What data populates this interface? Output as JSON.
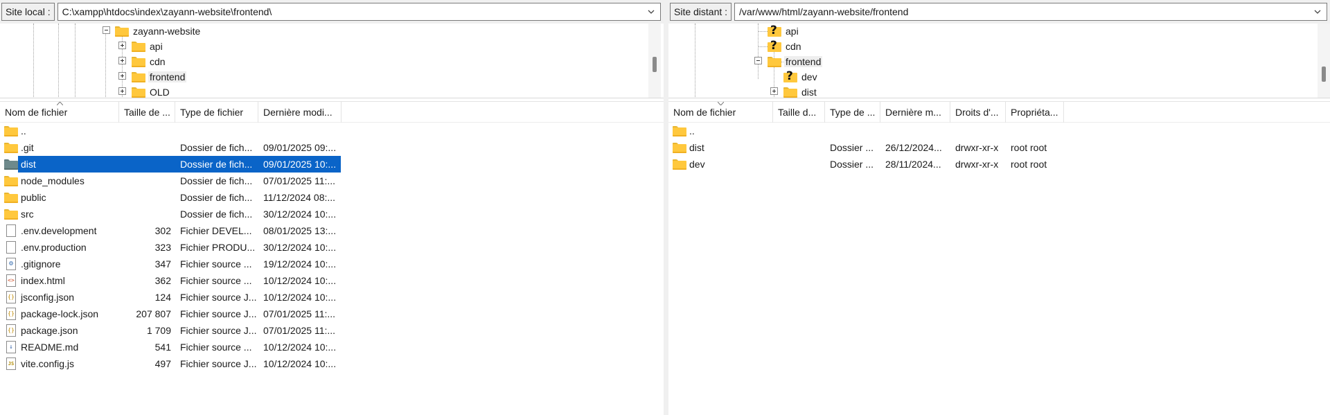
{
  "local": {
    "label": "Site local :",
    "path": "C:\\xampp\\htdocs\\index\\zayann-website\\frontend\\",
    "tree": [
      {
        "label": "zayann-website",
        "expanded": true
      },
      {
        "label": "api"
      },
      {
        "label": "cdn"
      },
      {
        "label": "frontend"
      },
      {
        "label": "OLD"
      }
    ],
    "columns": [
      "Nom de fichier",
      "Taille de ...",
      "Type de fichier",
      "Dernière modi..."
    ],
    "files": [
      {
        "name": "..",
        "size": "",
        "type": "",
        "modified": "",
        "icon": "folder"
      },
      {
        "name": ".git",
        "size": "",
        "type": "Dossier de fich...",
        "modified": "09/01/2025 09:...",
        "icon": "folder"
      },
      {
        "name": "dist",
        "size": "",
        "type": "Dossier de fich...",
        "modified": "09/01/2025 10:...",
        "icon": "folder-dark",
        "selected": true
      },
      {
        "name": "node_modules",
        "size": "",
        "type": "Dossier de fich...",
        "modified": "07/01/2025 11:...",
        "icon": "folder"
      },
      {
        "name": "public",
        "size": "",
        "type": "Dossier de fich...",
        "modified": "11/12/2024 08:...",
        "icon": "folder"
      },
      {
        "name": "src",
        "size": "",
        "type": "Dossier de fich...",
        "modified": "30/12/2024 10:...",
        "icon": "folder"
      },
      {
        "name": ".env.development",
        "size": "302",
        "type": "Fichier DEVEL...",
        "modified": "08/01/2025 13:...",
        "icon": "file"
      },
      {
        "name": ".env.production",
        "size": "323",
        "type": "Fichier PRODU...",
        "modified": "30/12/2024 10:...",
        "icon": "file"
      },
      {
        "name": ".gitignore",
        "size": "347",
        "type": "Fichier source ...",
        "modified": "19/12/2024 10:...",
        "icon": "gear"
      },
      {
        "name": "index.html",
        "size": "362",
        "type": "Fichier source ...",
        "modified": "10/12/2024 10:...",
        "icon": "code"
      },
      {
        "name": "jsconfig.json",
        "size": "124",
        "type": "Fichier source J...",
        "modified": "10/12/2024 10:...",
        "icon": "json"
      },
      {
        "name": "package-lock.json",
        "size": "207 807",
        "type": "Fichier source J...",
        "modified": "07/01/2025 11:...",
        "icon": "json"
      },
      {
        "name": "package.json",
        "size": "1 709",
        "type": "Fichier source J...",
        "modified": "07/01/2025 11:...",
        "icon": "json"
      },
      {
        "name": "README.md",
        "size": "541",
        "type": "Fichier source ...",
        "modified": "10/12/2024 10:...",
        "icon": "md"
      },
      {
        "name": "vite.config.js",
        "size": "497",
        "type": "Fichier source J...",
        "modified": "10/12/2024 10:...",
        "icon": "js"
      }
    ]
  },
  "remote": {
    "label": "Site distant :",
    "path": "/var/www/html/zayann-website/frontend",
    "tree": [
      {
        "label": "api",
        "icon": "unknown-folder"
      },
      {
        "label": "cdn",
        "icon": "unknown-folder"
      },
      {
        "label": "frontend",
        "icon": "folder",
        "expanded": true
      },
      {
        "label": "dev",
        "icon": "unknown-folder"
      },
      {
        "label": "dist",
        "icon": "folder"
      }
    ],
    "columns": [
      "Nom de fichier",
      "Taille d...",
      "Type de ...",
      "Dernière m...",
      "Droits d'...",
      "Propriéta..."
    ],
    "files": [
      {
        "name": "..",
        "size": "",
        "type": "",
        "modified": "",
        "perms": "",
        "owner": ""
      },
      {
        "name": "dist",
        "size": "",
        "type": "Dossier ...",
        "modified": "26/12/2024...",
        "perms": "drwxr-xr-x",
        "owner": "root root"
      },
      {
        "name": "dev",
        "size": "",
        "type": "Dossier ...",
        "modified": "28/11/2024...",
        "perms": "drwxr-xr-x",
        "owner": "root root"
      }
    ]
  },
  "icons": {
    "path_dropdown": "chevron-down-icon",
    "folder": "folder-icon",
    "unknown_folder": "unknown-folder-icon",
    "file": "file-icon",
    "sort": "sort-indicator-icon"
  },
  "colors": {
    "selection": "#0a64c8",
    "folder": "#ffc83d",
    "folder_dark": "#6e8a8c",
    "tree_highlight": "#eeeeee"
  }
}
